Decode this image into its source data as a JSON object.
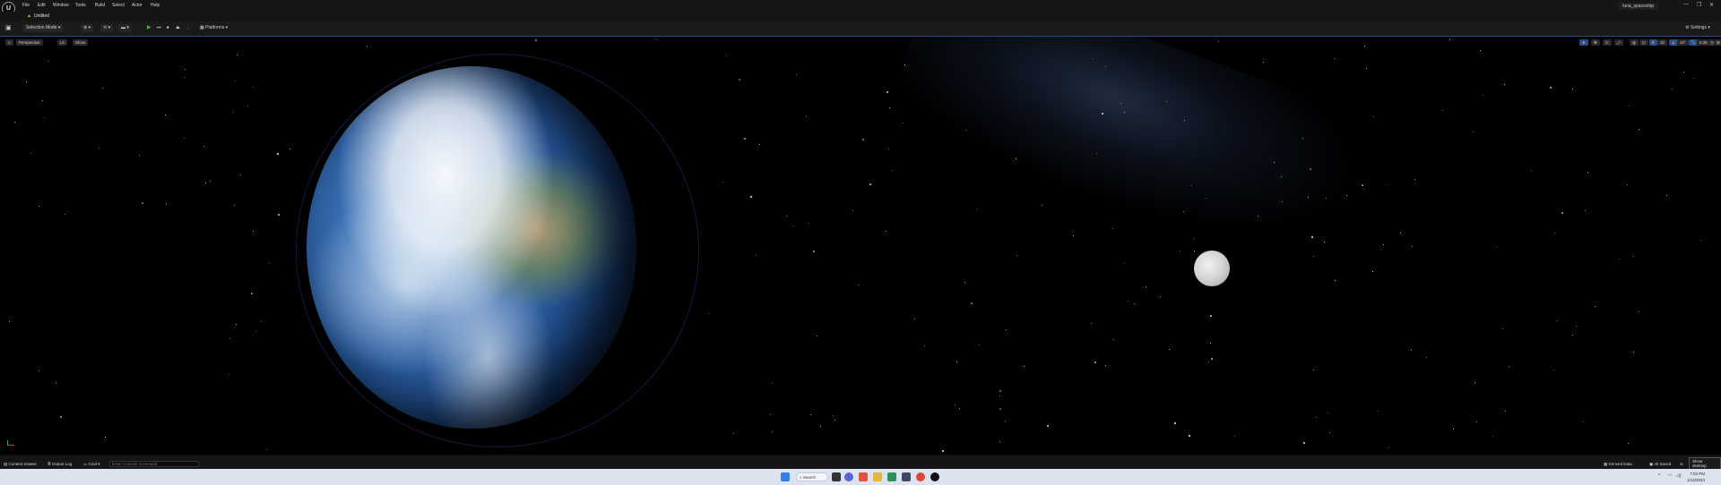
{
  "menubar": {
    "logo": "U",
    "items": [
      "File",
      "Edit",
      "Window",
      "Tools",
      "Build",
      "Select",
      "Actor",
      "Help"
    ],
    "project": "luna_spaceship",
    "window_controls": [
      "—",
      "❐",
      "✕"
    ]
  },
  "tab": {
    "title": "Untitled"
  },
  "toolbar": {
    "selection_mode": "Selection Mode",
    "platforms": "Platforms",
    "settings": "Settings"
  },
  "viewport": {
    "perspective": "Perspective",
    "lit": "Lit",
    "show": "Show",
    "right_values": [
      "10°",
      "0.25",
      "4"
    ]
  },
  "statusbar": {
    "content_drawer": "Content Drawer",
    "output_log": "Output Log",
    "cmd": "Cmd",
    "cmd_placeholder": "Enter Console Command",
    "derived_data": "Derived Data",
    "all_saved": "All Saved",
    "tooltip": "Show desktop"
  },
  "taskbar": {
    "search": "Search",
    "time": "7:02 PM",
    "date": "1/14/2024",
    "icons": [
      "windows-icon",
      "search-icon",
      "file-explorer-icon",
      "chat-icon",
      "brave-icon",
      "folder-icon",
      "edge-icon",
      "store-icon",
      "chrome-icon",
      "unreal-icon"
    ]
  }
}
